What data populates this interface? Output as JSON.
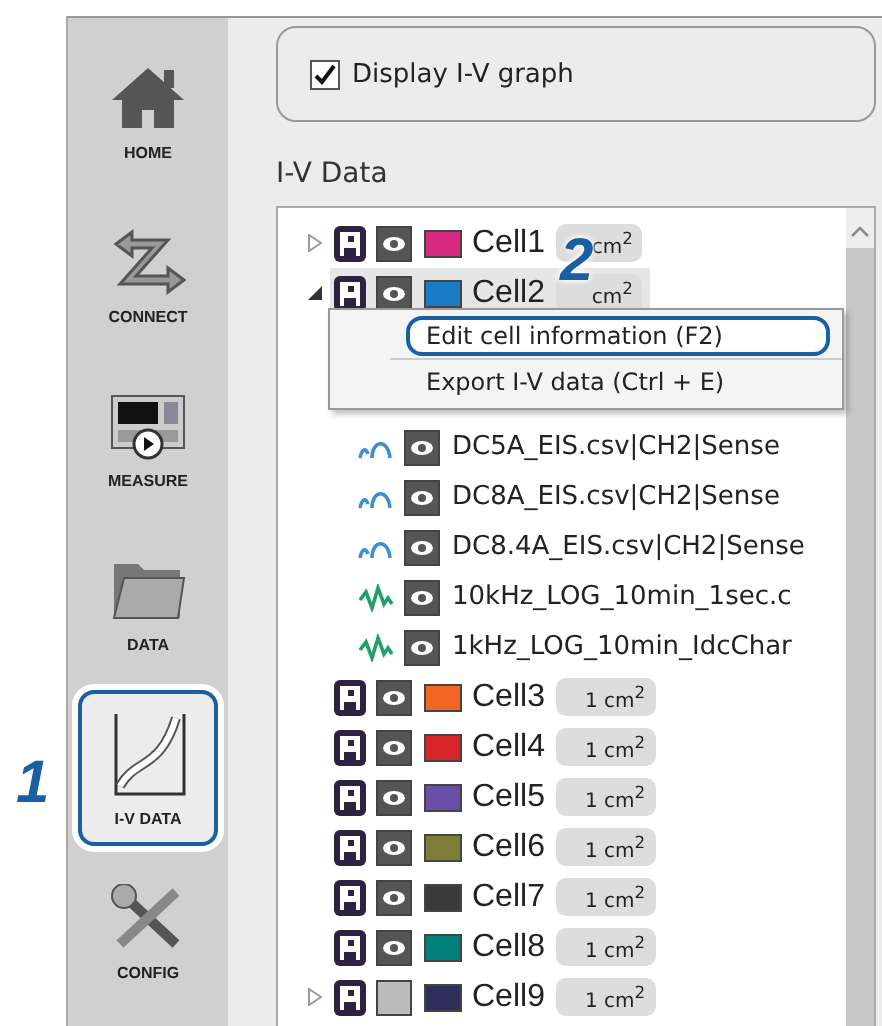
{
  "sidebar": {
    "items": [
      {
        "kind": "home",
        "label": "HOME",
        "selected": false
      },
      {
        "kind": "connect",
        "label": "CONNECT",
        "selected": false
      },
      {
        "kind": "measure",
        "label": "MEASURE",
        "selected": false
      },
      {
        "kind": "data",
        "label": "DATA",
        "selected": false
      },
      {
        "kind": "ivdata",
        "label": "I-V DATA",
        "selected": true
      },
      {
        "kind": "config",
        "label": "CONFIG",
        "selected": false
      }
    ]
  },
  "callouts": [
    {
      "label": "1"
    },
    {
      "label": "2"
    }
  ],
  "graph_toggle": {
    "label": "Display I-V graph",
    "checked": true
  },
  "section_title": "I-V Data",
  "tree": {
    "items": [
      {
        "name": "Cell1",
        "area": "cm$^{2}$",
        "color": "#d6287f",
        "visible": true,
        "expanded": false,
        "selected": false
      },
      {
        "name": "Cell2",
        "area": "cm$^{2}$",
        "color": "#1a7cc4",
        "visible": true,
        "expanded": true,
        "selected": true,
        "children": [
          {
            "kind": "eis",
            "name": "DC5A_EIS.csv|CH2|Sense"
          },
          {
            "kind": "eis",
            "name": "DC8A_EIS.csv|CH2|Sense"
          },
          {
            "kind": "eis",
            "name": "DC8.4A_EIS.csv|CH2|Sense"
          },
          {
            "kind": "log",
            "name": "10kHz_LOG_10min_1sec.c"
          },
          {
            "kind": "log",
            "name": "1kHz_LOG_10min_IdcChar"
          }
        ]
      },
      {
        "name": "Cell3",
        "area": "1 cm$^{2}$",
        "color": "#f26522",
        "visible": true,
        "selected": false
      },
      {
        "name": "Cell4",
        "area": "1 cm$^{2}$",
        "color": "#d7232a",
        "visible": true,
        "selected": false
      },
      {
        "name": "Cell5",
        "area": "1 cm$^{2}$",
        "color": "#6a4fa8",
        "visible": true,
        "selected": false
      },
      {
        "name": "Cell6",
        "area": "1 cm$^{2}$",
        "color": "#7d7d38",
        "visible": true,
        "selected": false
      },
      {
        "name": "Cell7",
        "area": "1 cm$^{2}$",
        "color": "#3a3a3a",
        "visible": true,
        "selected": false
      },
      {
        "name": "Cell8",
        "area": "1 cm$^{2}$",
        "color": "#00807a",
        "visible": true,
        "selected": false
      },
      {
        "name": "Cell9",
        "area": "1 cm$^{2}$",
        "color": "#2e2e5a",
        "visible": false,
        "expanded": false,
        "selected": false
      }
    ]
  },
  "context_menu": {
    "items": [
      {
        "label": "Edit cell information (F2)",
        "highlighted": true
      },
      {
        "label": "Export I-V data (Ctrl + E)",
        "highlighted": false
      }
    ]
  }
}
